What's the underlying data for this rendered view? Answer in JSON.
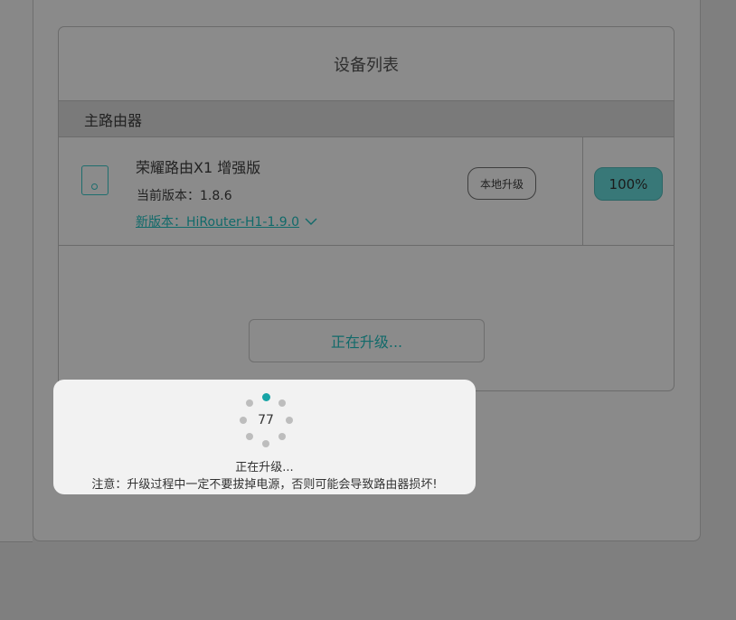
{
  "card": {
    "title": "设备列表",
    "section_label": "主路由器"
  },
  "device": {
    "name": "荣耀路由X1 增强版",
    "current_version": "当前版本：1.8.6",
    "new_version": "新版本：HiRouter-H1-1.9.0",
    "local_upgrade_label": "本地升级",
    "progress_label": "100%",
    "progress_value": 100
  },
  "upgrade_button_label": "正在升级...",
  "modal": {
    "progress_number": "77",
    "status": "正在升级...",
    "warning": "注意：升级过程中一定不要拔掉电源，否则可能会导致路由器损坏!"
  },
  "colors": {
    "accent": "#17a4a6",
    "modal_bg": "#f2f2f2",
    "overlay": "#7f7f7f"
  },
  "icons": {
    "device": "router-icon",
    "expand": "chevron-down-icon",
    "spinner": "loading-spinner-icon"
  }
}
